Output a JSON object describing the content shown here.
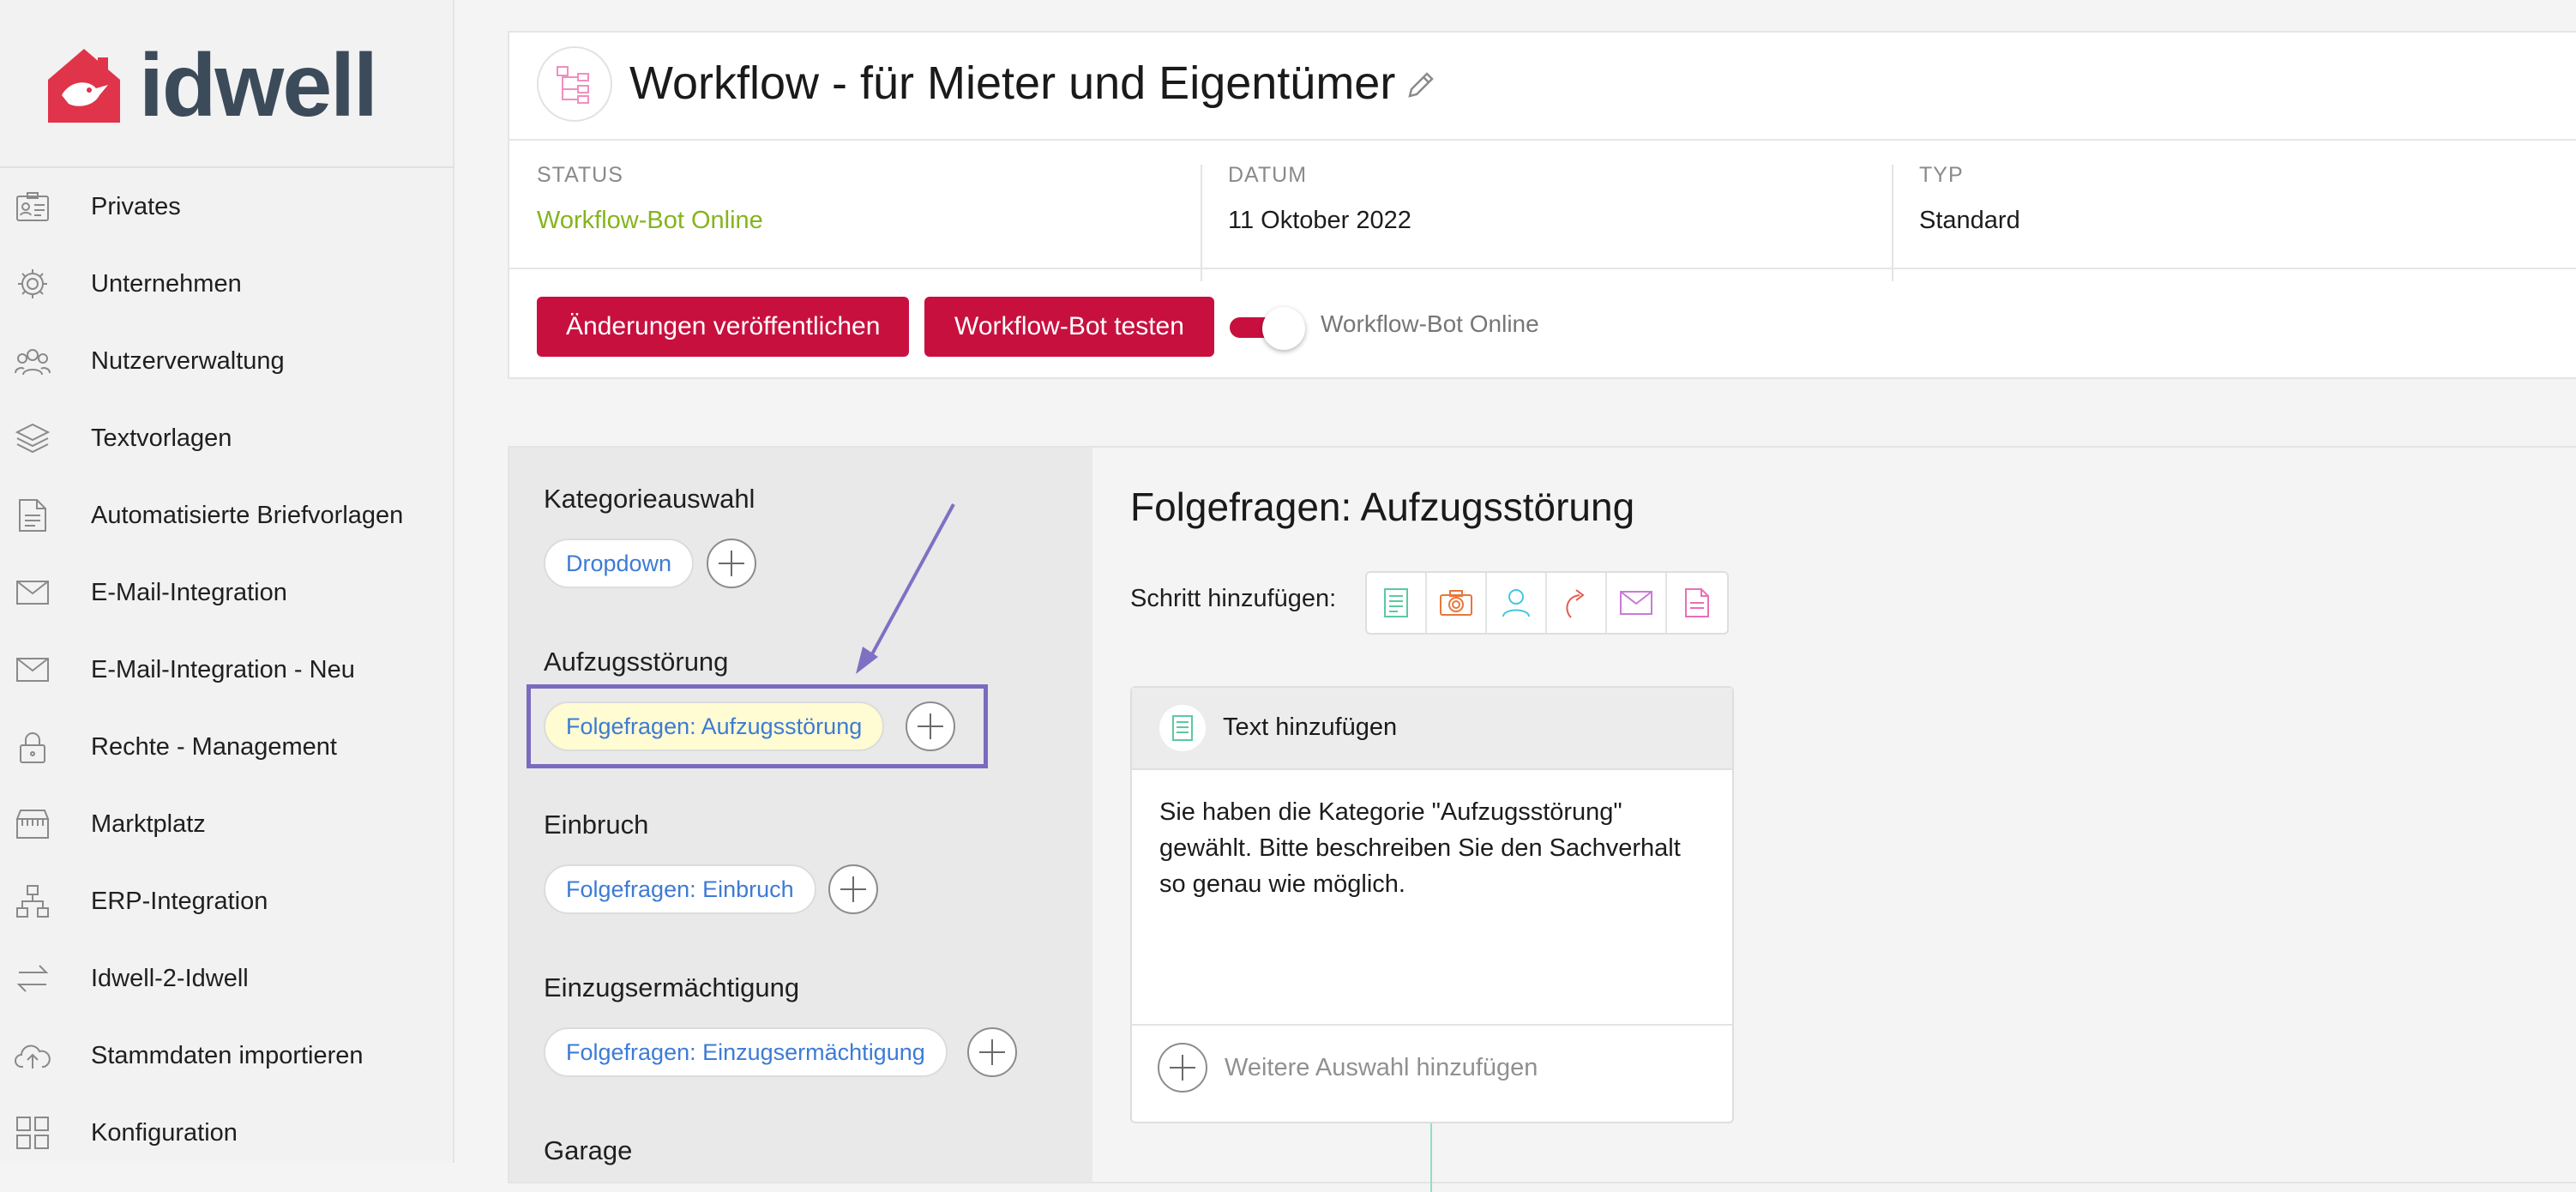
{
  "brand": {
    "name": "idwell",
    "accent": "#c8103f",
    "logo_red": "#e0344a",
    "logo_text": "#3c4b5a"
  },
  "sidebar": {
    "items": [
      {
        "label": "Privates",
        "icon": "id-card-icon"
      },
      {
        "label": "Unternehmen",
        "icon": "gear-icon"
      },
      {
        "label": "Nutzerverwaltung",
        "icon": "users-icon"
      },
      {
        "label": "Textvorlagen",
        "icon": "layers-icon"
      },
      {
        "label": "Automatisierte Briefvorlagen",
        "icon": "document-icon"
      },
      {
        "label": "E-Mail-Integration",
        "icon": "envelope-icon"
      },
      {
        "label": "E-Mail-Integration - Neu",
        "icon": "envelope-icon"
      },
      {
        "label": "Rechte - Management",
        "icon": "lock-icon"
      },
      {
        "label": "Marktplatz",
        "icon": "store-icon"
      },
      {
        "label": "ERP-Integration",
        "icon": "network-icon"
      },
      {
        "label": "Idwell-2-Idwell",
        "icon": "swap-arrows-icon"
      },
      {
        "label": "Stammdaten importieren",
        "icon": "cloud-upload-icon"
      },
      {
        "label": "Konfiguration",
        "icon": "grid-icon"
      }
    ]
  },
  "header": {
    "title": "Workflow - für Mieter und Eigentümer",
    "status_label": "STATUS",
    "status_value": "Workflow-Bot Online",
    "status_color": "#85b41c",
    "date_label": "DATUM",
    "date_value": "11 Oktober 2022",
    "type_label": "TYP",
    "type_value": "Standard",
    "publish_button": "Änderungen veröffentlichen",
    "test_button": "Workflow-Bot testen",
    "toggle_label": "Workflow-Bot Online",
    "toggle_on": true
  },
  "categories": [
    {
      "title": "Kategorieauswahl",
      "chip": "Dropdown"
    },
    {
      "title": "Aufzugsstörung",
      "chip": "Folgefragen: Aufzugsstörung",
      "active": true
    },
    {
      "title": "Einbruch",
      "chip": "Folgefragen: Einbruch"
    },
    {
      "title": "Einzugsermächtigung",
      "chip": "Folgefragen: Einzugsermächtigung"
    },
    {
      "title": "Garage"
    }
  ],
  "detail": {
    "title": "Folgefragen: Aufzugsstörung",
    "add_step_label": "Schritt hinzufügen:",
    "step_types": [
      {
        "icon": "text-icon",
        "color": "#5cc9a0"
      },
      {
        "icon": "camera-icon",
        "color": "#e8763a"
      },
      {
        "icon": "person-icon",
        "color": "#44c6dd"
      },
      {
        "icon": "redirect-arrow-icon",
        "color": "#e8594f"
      },
      {
        "icon": "envelope-icon",
        "color": "#c97ad8"
      },
      {
        "icon": "document-icon",
        "color": "#e86fb8"
      }
    ],
    "step": {
      "header": "Text hinzufügen",
      "body": "Sie haben die Kategorie \"Aufzugsstörung\"\ngewählt.  Bitte beschreiben Sie den Sachverhalt\nso genau wie möglich.",
      "add_choice": "Weitere Auswahl hinzufügen"
    }
  }
}
